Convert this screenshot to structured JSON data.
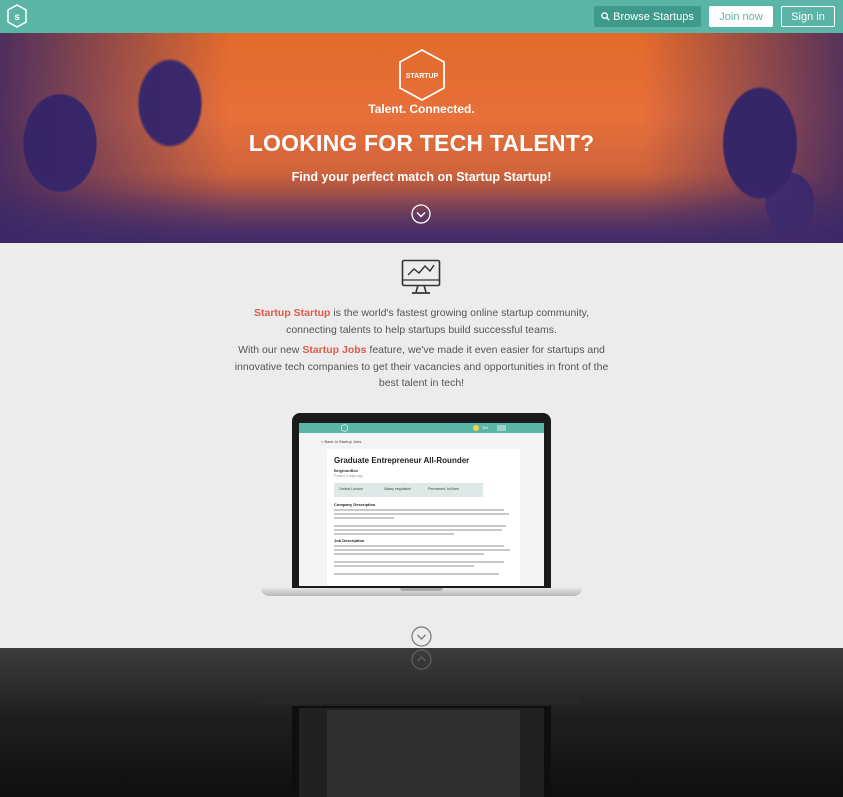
{
  "nav": {
    "browse_label": "Browse Startups",
    "join_label": "Join now",
    "signin_label": "Sign in",
    "logo_text": "s"
  },
  "hero": {
    "logo_text": "STARTUP",
    "tagline": "Talent. Connected.",
    "title": "LOOKING FOR TECH TALENT?",
    "subtitle": "Find your perfect match on Startup Startup!"
  },
  "intro": {
    "p1_brand": "Startup Startup",
    "p1_rest": " is the world's fastest growing online startup community, connecting talents to help startups build successful teams.",
    "p2_start": "With our new ",
    "p2_brand": "Startup Jobs",
    "p2_rest": " feature, we've made it even easier for startups and innovative tech companies to get their vacancies and opportunities in front of the best talent in tech!"
  },
  "laptop_screen": {
    "back_link": "< Back to Startup Jobs",
    "job_title": "Graduate Entrepreneur All-Rounder",
    "company": "BrightonBox",
    "posted": "Posted 4 days ago",
    "tags": [
      "Central London",
      "Salary negotiable",
      "Permanent, full time"
    ],
    "section1": "Company Description",
    "section2": "Job Description",
    "user_label": "Ted"
  },
  "colors": {
    "brand_teal": "#5bb5a6",
    "brand_teal_dark": "#3e9a8b",
    "highlight_red": "#e05a4a",
    "hero_orange": "#e16a2b",
    "hero_purple": "#3b2b6e"
  },
  "icons": {
    "browse": "search-icon",
    "hero_scroll": "chevron-down-icon",
    "features": "monitor-chart-icon",
    "body_scroll": "chevron-down-icon"
  }
}
